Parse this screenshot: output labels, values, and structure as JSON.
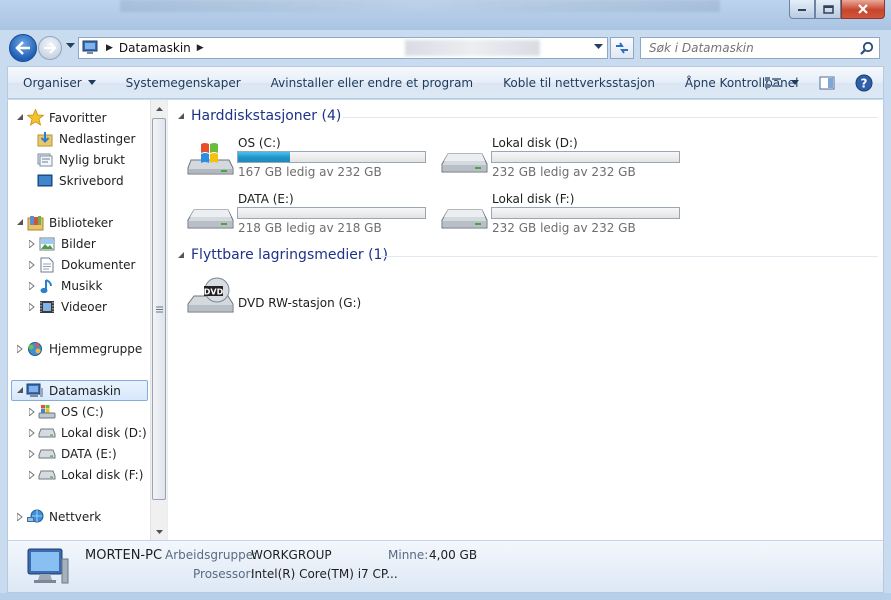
{
  "window": {
    "colors": {
      "frame": "#bcd3ec",
      "accent": "#1e3287",
      "progress": "#2293c8",
      "close": "#c7452c"
    }
  },
  "nav": {
    "breadcrumb": [
      "Datamaskin"
    ],
    "search_placeholder": "Søk i Datamaskin"
  },
  "commands": {
    "organize": "Organiser",
    "items": [
      "Systemegenskaper",
      "Avinstaller eller endre et program",
      "Koble til nettverksstasjon",
      "Åpne Kontrollpanel"
    ]
  },
  "sidebar": {
    "favorites": {
      "label": "Favoritter",
      "items": [
        "Nedlastinger",
        "Nylig brukt",
        "Skrivebord"
      ]
    },
    "libraries": {
      "label": "Biblioteker",
      "items": [
        "Bilder",
        "Dokumenter",
        "Musikk",
        "Videoer"
      ]
    },
    "homegroup": "Hjemmegruppe",
    "computer": {
      "label": "Datamaskin",
      "items": [
        "OS (C:)",
        "Lokal disk (D:)",
        "DATA (E:)",
        "Lokal disk (F:)"
      ]
    },
    "network": "Nettverk"
  },
  "groups": {
    "hdd": {
      "title": "Harddiskstasjoner (4)",
      "drives": [
        {
          "name": "OS (C:)",
          "free": "167 GB ledig av 232 GB",
          "used_fraction": 0.28
        },
        {
          "name": "Lokal disk (D:)",
          "free": "232 GB ledig av 232 GB",
          "used_fraction": 0.0
        },
        {
          "name": "DATA (E:)",
          "free": "218 GB ledig av 218 GB",
          "used_fraction": 0.0
        },
        {
          "name": "Lokal disk (F:)",
          "free": "232 GB ledig av 232 GB",
          "used_fraction": 0.0
        }
      ]
    },
    "removable": {
      "title": "Flyttbare lagringsmedier (1)",
      "drives": [
        {
          "name": "DVD RW-stasjon (G:)"
        }
      ]
    }
  },
  "details": {
    "computer_name": "MORTEN-PC",
    "workgroup_label": "Arbeidsgruppe:",
    "workgroup_value": "WORKGROUP",
    "memory_label": "Minne:",
    "memory_value": "4,00 GB",
    "processor_label": "Prosessor:",
    "processor_value": "Intel(R) Core(TM) i7 CP..."
  }
}
